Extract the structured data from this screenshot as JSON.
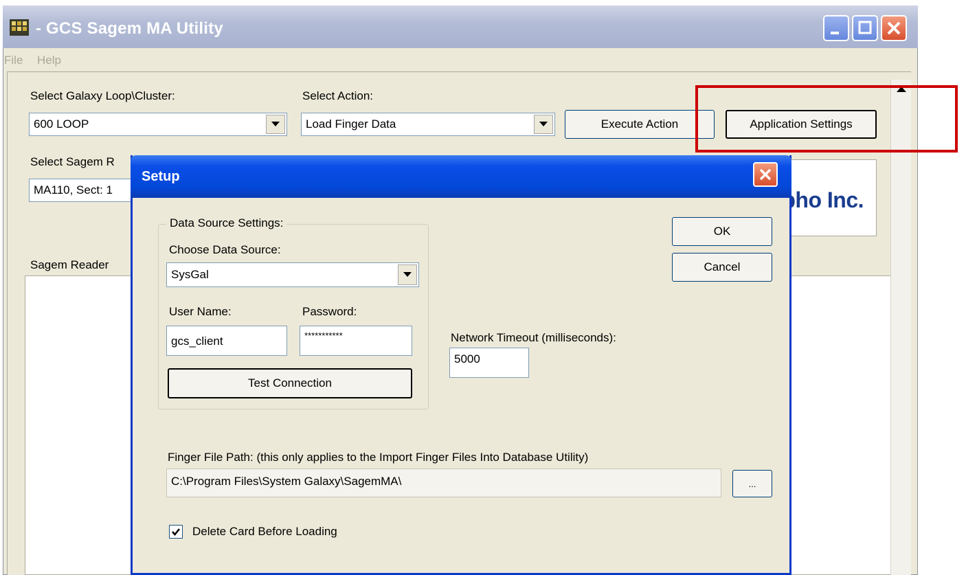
{
  "window": {
    "title": "- GCS Sagem MA Utility"
  },
  "menu": {
    "file": "File",
    "help": "Help"
  },
  "main": {
    "galaxy_label": "Select Galaxy Loop\\Cluster:",
    "galaxy_value": "600 LOOP",
    "action_label": "Select Action:",
    "action_value": "Load Finger Data",
    "execute_button": "Execute Action",
    "app_settings_button": "Application Settings",
    "reader_label": "Select Sagem R",
    "reader_value": "MA110, Sect: 1",
    "list_header": "Sagem Reader",
    "logo_text": "pho Inc."
  },
  "annotation": {
    "color": "#cc0000"
  },
  "dialog": {
    "title": "Setup",
    "ok_button": "OK",
    "cancel_button": "Cancel",
    "data_source_group": "Data Source Settings:",
    "choose_source_label": "Choose Data Source:",
    "source_value": "SysGal",
    "username_label": "User Name:",
    "username_value": "gcs_client",
    "password_label": "Password:",
    "password_value": "***********",
    "test_button": "Test Connection",
    "timeout_label": "Network Timeout (milliseconds):",
    "timeout_value": "5000",
    "finger_path_label": "Finger File Path: (this only applies to the Import Finger Files Into Database Utility)",
    "finger_path_value": "C:\\Program Files\\System Galaxy\\SagemMA\\",
    "browse_button": "...",
    "delete_card_label": "Delete Card Before Loading",
    "delete_card_checked": true
  }
}
